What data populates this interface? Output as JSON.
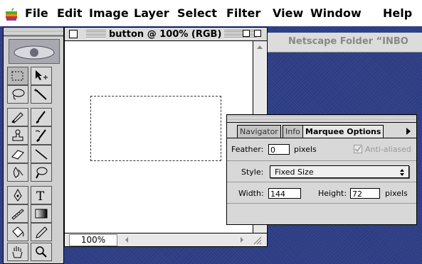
{
  "menubar": {
    "items": [
      "File",
      "Edit",
      "Image",
      "Layer",
      "Select",
      "Filter",
      "View",
      "Window",
      "Help"
    ]
  },
  "netscape_window": {
    "title": "Netscape Folder “INBO"
  },
  "document_window": {
    "title": "button @ 100% (RGB)",
    "zoom": "100%"
  },
  "marquee_palette": {
    "tabs": [
      "Navigator",
      "Info",
      "Marquee Options"
    ],
    "feather_label": "Feather:",
    "feather_value": "0",
    "feather_unit": "pixels",
    "antialiased_label": "Anti-aliased",
    "style_label": "Style:",
    "style_value": "Fixed Size",
    "width_label": "Width:",
    "width_value": "144",
    "height_label": "Height:",
    "height_value": "72",
    "size_unit": "pixels"
  },
  "colors": {
    "desktop": "#2e3e86",
    "window_chrome": "#dcdcdc",
    "apple_green": "#4cae2a",
    "apple_orange": "#f08a1c",
    "apple_purple": "#8a3fa0"
  },
  "icons": {
    "tools": [
      "marquee-icon",
      "move-icon",
      "lasso-icon",
      "magic-wand-icon",
      "airbrush-icon",
      "paintbrush-icon",
      "rubber-stamp-icon",
      "history-brush-icon",
      "eraser-icon",
      "line-icon",
      "blur-icon",
      "dodge-icon",
      "pen-icon",
      "type-icon",
      "measure-icon",
      "gradient-icon",
      "paint-bucket-icon",
      "eyedropper-icon",
      "hand-icon",
      "zoom-icon"
    ]
  }
}
